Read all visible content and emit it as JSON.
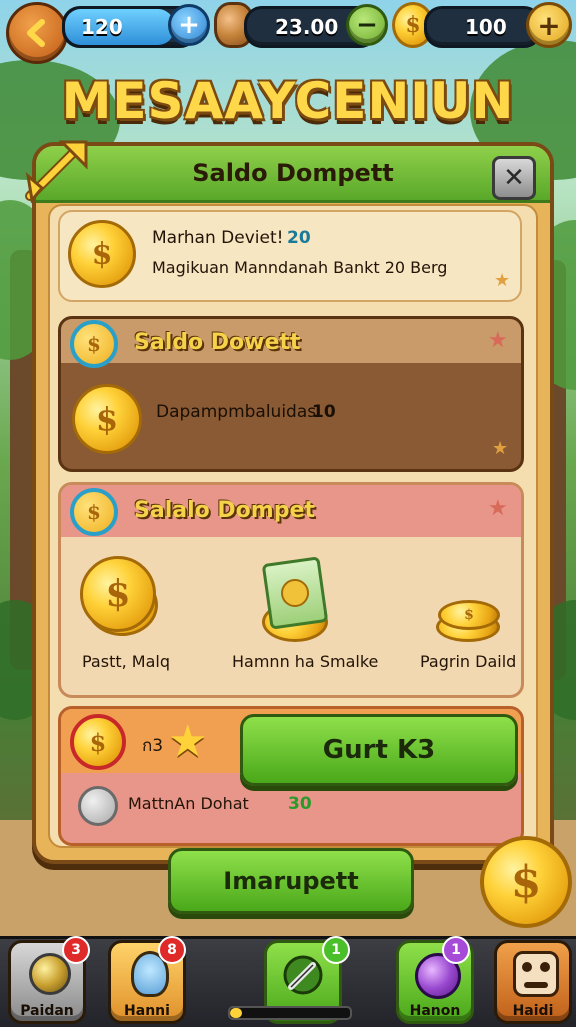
{
  "hud": {
    "gems_value": "120",
    "coins_value": "23.00",
    "gold_value": "100",
    "plus_glyph": "+",
    "minus_glyph": "−",
    "back_icon": "chevron-left-icon"
  },
  "title": "MESAAYCENIUN",
  "panel": {
    "title": "Saldo Dompett",
    "close_glyph": "✕",
    "top_card": {
      "line1": "Marhan Deviet!",
      "line1_value": "20",
      "line2": "Magikuan Manndanah Bankt 20 Berg"
    },
    "section1": {
      "title": "Saldo Dowett",
      "text": "Dapampmbaluidas",
      "value": "10"
    },
    "section2": {
      "title": "Salalo Dompet",
      "items": [
        {
          "label": "Pastt, Malq"
        },
        {
          "label": "Hamnn ha Smalke"
        },
        {
          "label": "Pagrin Daild"
        }
      ]
    },
    "section3": {
      "prefix": "ก3",
      "button_label": "Gurt K3",
      "text": "MattnAn Dohat",
      "value": "30"
    },
    "bottom_button": "Imarupett"
  },
  "nav": {
    "items": [
      {
        "label": "Paidan",
        "badge": "3"
      },
      {
        "label": "Hanni",
        "badge": "8"
      },
      {
        "label": "",
        "badge": "1"
      },
      {
        "label": "Hanon",
        "badge": "1"
      },
      {
        "label": "Haidi",
        "badge": ""
      }
    ]
  },
  "colors": {
    "accent_green": "#5aa82a",
    "coin_gold": "#ffd23a",
    "panel_brown": "#7a4a16",
    "badge_red": "#e02a2a"
  }
}
